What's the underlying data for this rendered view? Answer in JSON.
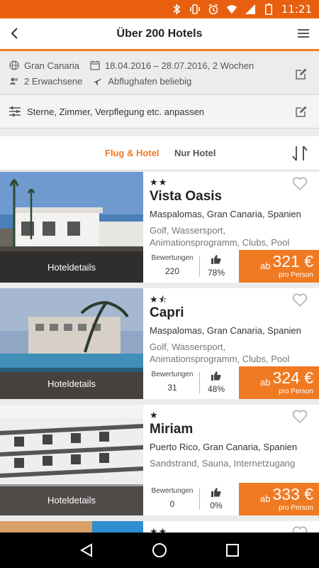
{
  "status_bar": {
    "time": "11:21"
  },
  "header": {
    "title": "Über 200 Hotels"
  },
  "search": {
    "destination": "Gran Canaria",
    "dates": "18.04.2016 – 28.07.2016, 2 Wochen",
    "travelers": "2 Erwachsene",
    "airport": "Abflughafen beliebig"
  },
  "filter": {
    "label": "Sterne, Zimmer, Verpflegung etc. anpassen"
  },
  "tabs": {
    "active": "Flug & Hotel",
    "inactive": "Nur Hotel"
  },
  "hotels": [
    {
      "stars": "★★",
      "name": "Vista Oasis",
      "location": "Maspalomas, Gran Canaria, Spanien",
      "features": "Golf, Wassersport, Animationsprogramm, Clubs, Pool",
      "details_label": "Hoteldetails",
      "reviews_label": "Bewertungen",
      "reviews_count": "220",
      "recommend": "78%",
      "price_prefix": "ab",
      "price": "321 €",
      "price_unit": "pro Person"
    },
    {
      "stars": "★⯪",
      "name": "Capri",
      "location": "Maspalomas, Gran Canaria, Spanien",
      "features": "Golf, Wassersport, Animationsprogramm, Clubs, Pool",
      "details_label": "Hoteldetails",
      "reviews_label": "Bewertungen",
      "reviews_count": "31",
      "recommend": "48%",
      "price_prefix": "ab",
      "price": "324 €",
      "price_unit": "pro Person"
    },
    {
      "stars": "★",
      "name": "Miriam",
      "location": "Puerto Rico, Gran Canaria, Spanien",
      "features": "Sandstrand, Sauna, Internetzugang",
      "details_label": "Hoteldetails",
      "reviews_label": "Bewertungen",
      "reviews_count": "0",
      "recommend": "0%",
      "price_prefix": "ab",
      "price": "333 €",
      "price_unit": "pro Person"
    },
    {
      "stars": "★★"
    }
  ],
  "colors": {
    "accent": "#f07a22",
    "status_bar": "#e8600f"
  },
  "icons": [
    "back-icon",
    "menu-icon",
    "globe-icon",
    "calendar-icon",
    "people-icon",
    "plane-icon",
    "edit-icon",
    "sliders-icon",
    "sort-icon",
    "heart-icon",
    "thumbs-up-icon",
    "nav-back-icon",
    "nav-home-icon",
    "nav-recents-icon"
  ]
}
